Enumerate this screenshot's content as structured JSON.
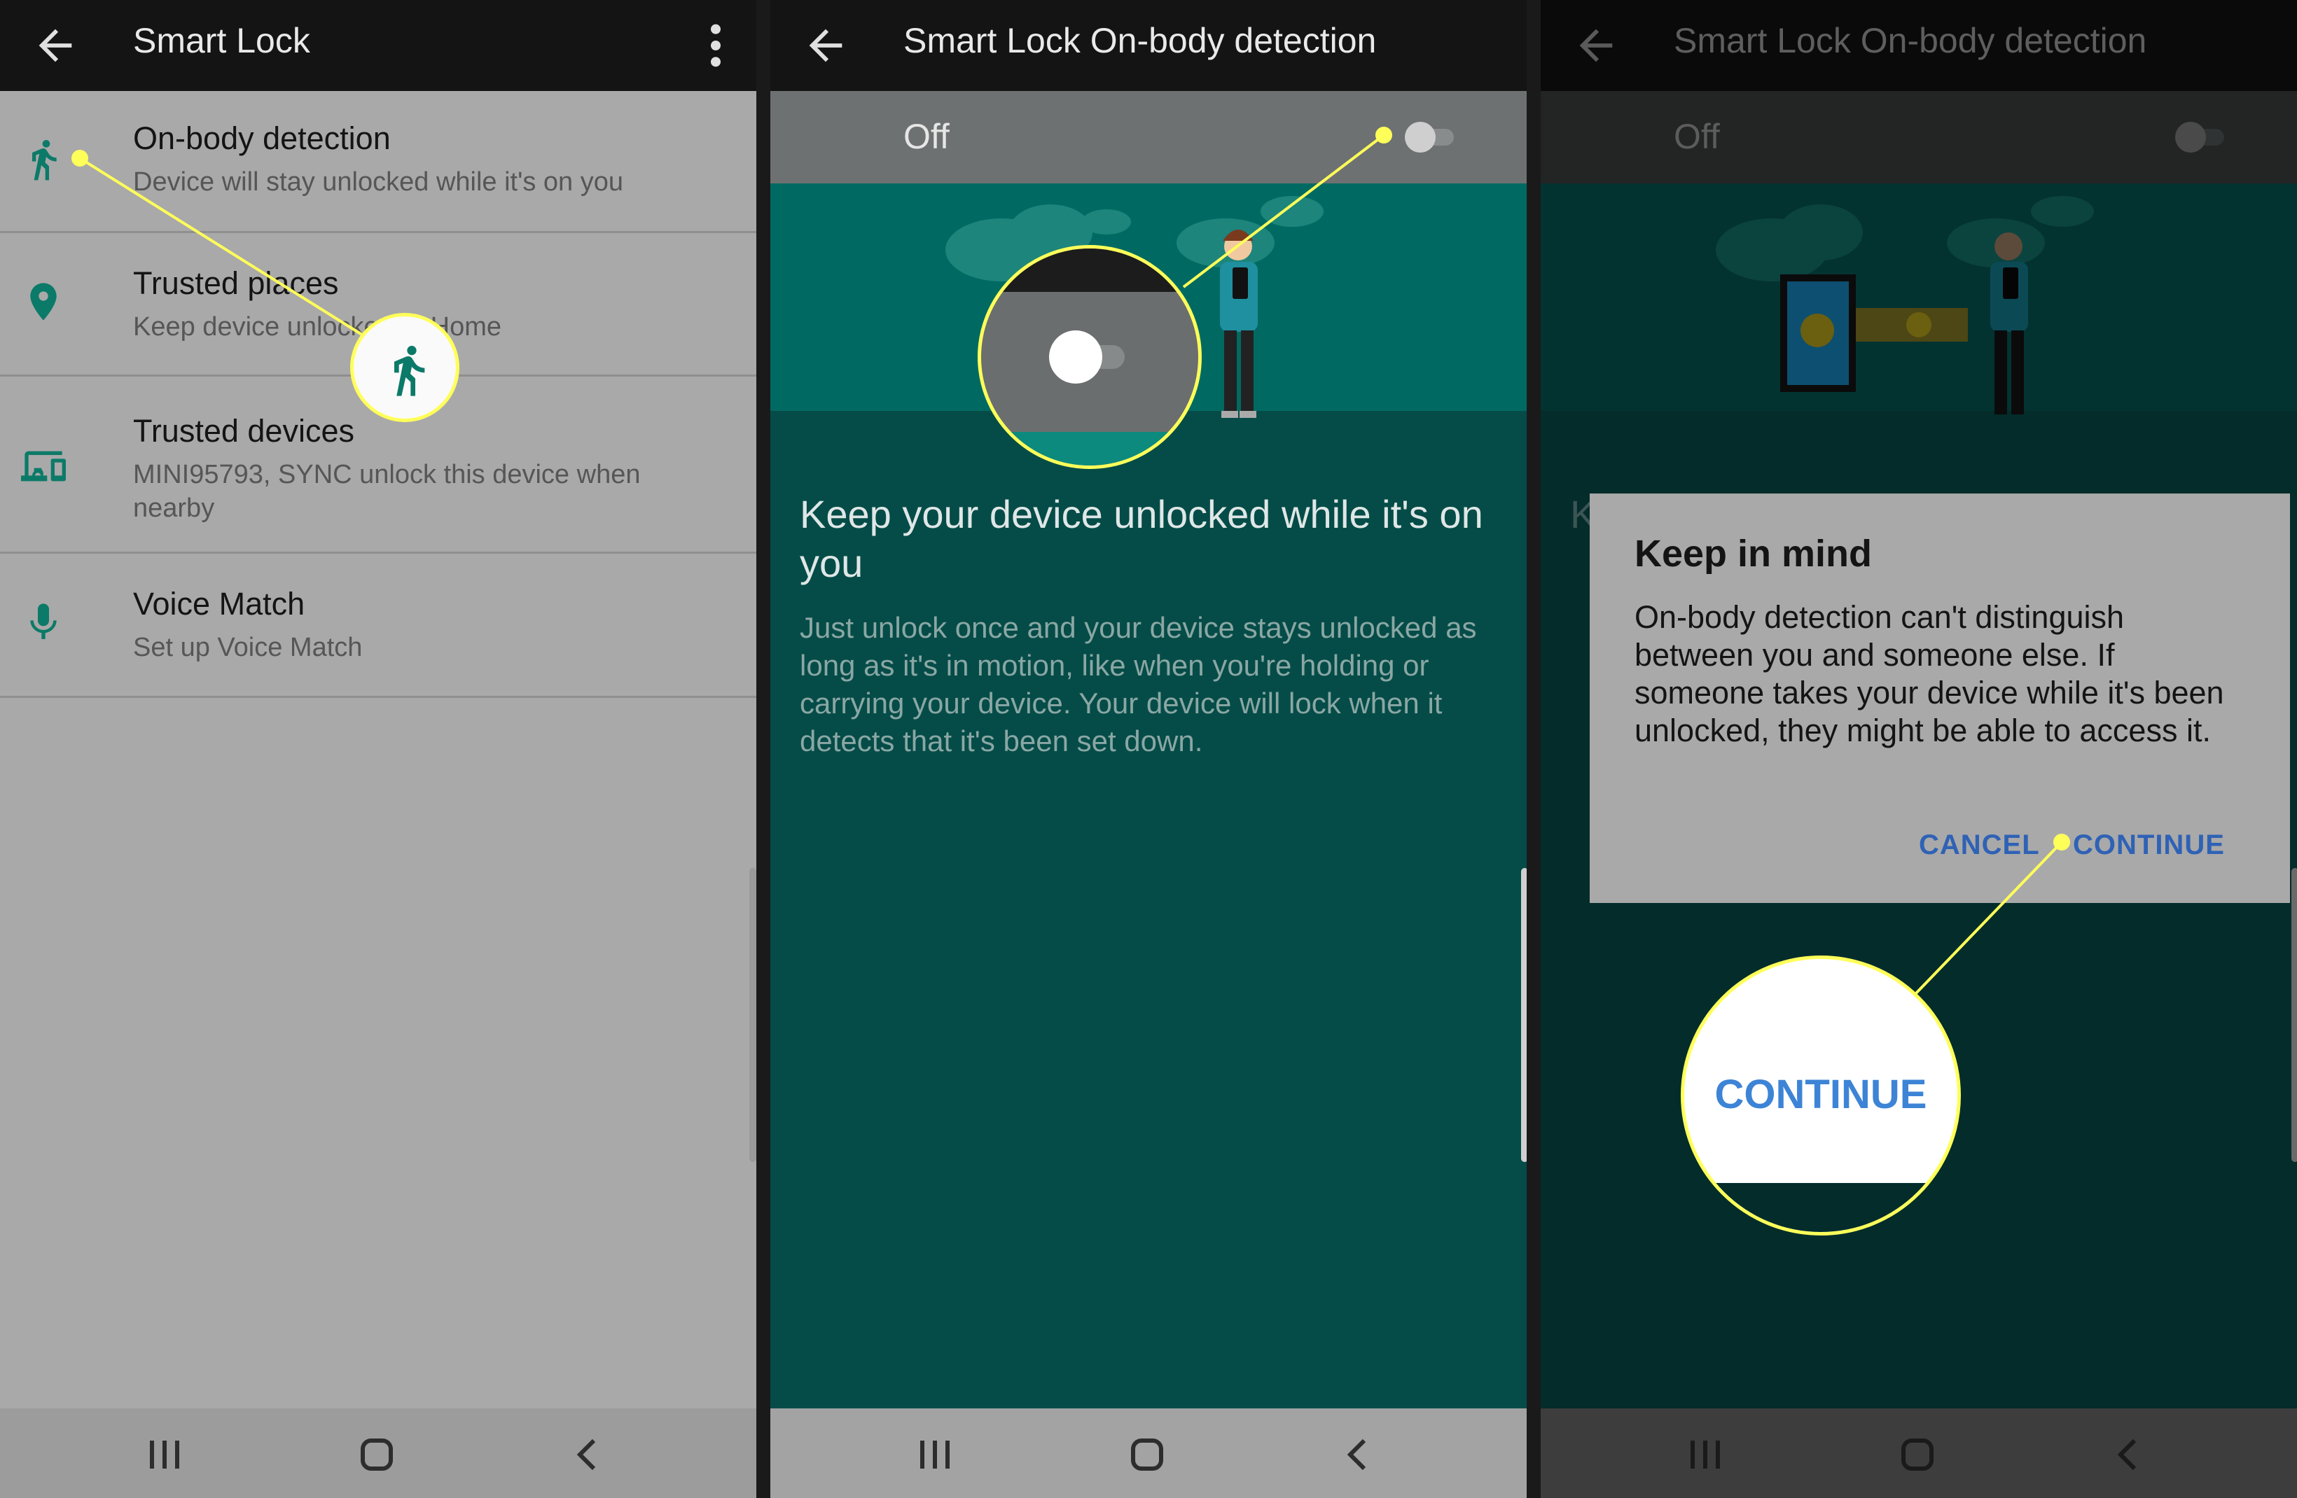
{
  "colors": {
    "accent_teal": "#0c7a68",
    "highlight_yellow": "#ffff5a",
    "dialog_button_blue": "#2f62b5"
  },
  "panel1": {
    "title": "Smart Lock",
    "items": [
      {
        "icon": "walking-person-icon",
        "title": "On-body detection",
        "subtitle": "Device will stay unlocked while it's on you"
      },
      {
        "icon": "location-pin-icon",
        "title": "Trusted places",
        "subtitle": "Keep device unlocked at Home"
      },
      {
        "icon": "devices-icon",
        "title": "Trusted devices",
        "subtitle": "MINI95793, SYNC unlock this device when nearby"
      },
      {
        "icon": "microphone-icon",
        "title": "Voice Match",
        "subtitle": "Set up Voice Match"
      }
    ]
  },
  "panel2": {
    "title": "Smart Lock On-body detection",
    "toggle_label": "Off",
    "toggle_on": false,
    "headline": "Keep your device unlocked while it's on you",
    "body": "Just unlock once and your device stays unlocked as long as it's in motion, like when you're holding or carrying your device. Your device will lock when it detects that it's been set down."
  },
  "panel3": {
    "title": "Smart Lock On-body detection",
    "toggle_label": "Off",
    "partial_heading_start": "K",
    "dialog": {
      "title": "Keep in mind",
      "body": "On-body detection can't distinguish between you and someone else. If someone takes your device while it's been unlocked, they might be able to access it.",
      "cancel": "CANCEL",
      "continue": "CONTINUE"
    },
    "callout_label": "CONTINUE"
  }
}
